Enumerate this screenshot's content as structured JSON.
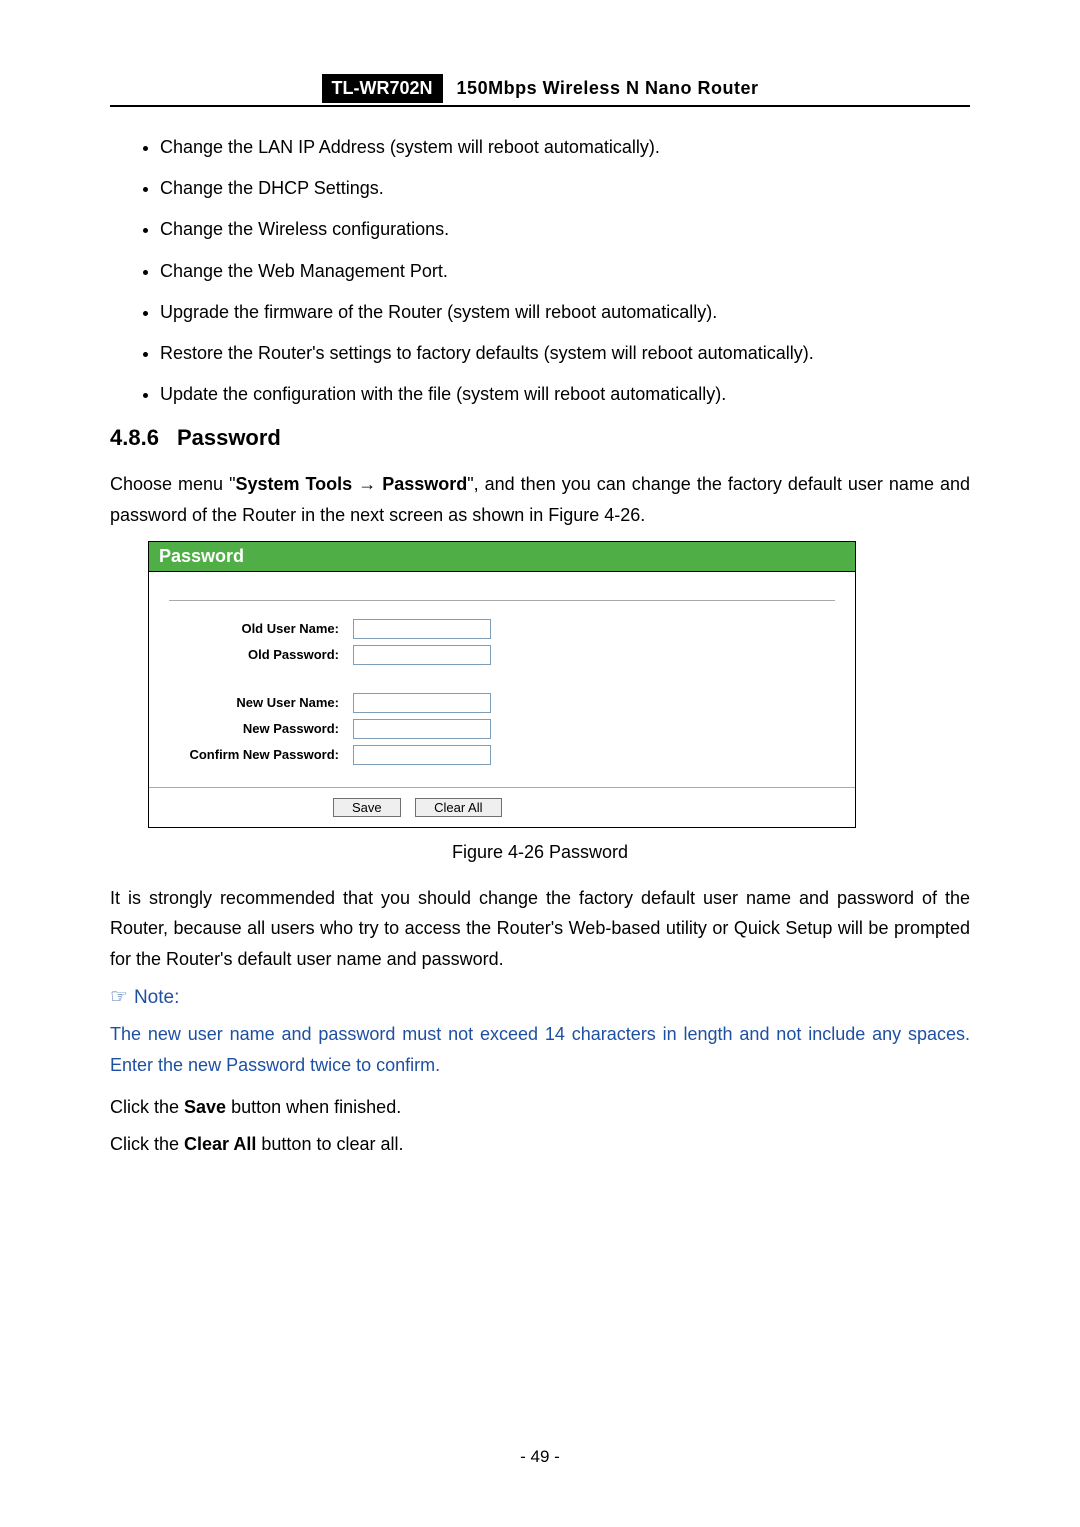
{
  "header": {
    "model": "TL-WR702N",
    "desc": "150Mbps  Wireless  N  Nano  Router"
  },
  "bullets": [
    "Change the LAN IP Address (system will reboot automatically).",
    "Change the DHCP Settings.",
    "Change the Wireless configurations.",
    "Change the Web Management Port.",
    "Upgrade the firmware of the Router (system will reboot automatically).",
    "Restore the Router's settings to factory defaults (system will reboot automatically).",
    "Update the configuration with the file (system will reboot automatically)."
  ],
  "section": {
    "number": "4.8.6",
    "title": "Password"
  },
  "intro": {
    "pre": "Choose menu \"",
    "menu1": "System Tools",
    "arrow": "→",
    "menu2": "Password",
    "post": "\", and then you can change the factory default user name and password of the Router in the next screen as shown in Figure 4-26."
  },
  "panel": {
    "title": "Password",
    "labels": {
      "oldUser": "Old User Name:",
      "oldPass": "Old Password:",
      "newUser": "New User Name:",
      "newPass": "New Password:",
      "confirm": "Confirm New Password:"
    },
    "values": {
      "oldUser": "",
      "oldPass": "",
      "newUser": "",
      "newPass": "",
      "confirm": ""
    },
    "buttons": {
      "save": "Save",
      "clear": "Clear All"
    }
  },
  "figCaption": "Figure 4-26    Password",
  "recommend": "It is strongly recommended that you should change the factory default user name and password of the Router, because all users who try to access the Router's Web-based utility or Quick Setup will be prompted for the Router's default user name and password.",
  "note": {
    "icon": "☞",
    "label": "Note:",
    "body": "The new user name and password must not exceed 14 characters in length and not include any spaces. Enter the new Password twice to confirm."
  },
  "clickSave": {
    "pre": "Click the ",
    "bold": "Save",
    "post": " button when finished."
  },
  "clickClear": {
    "pre": "Click the ",
    "bold": "Clear All",
    "post": " button to clear all."
  },
  "pageNumber": "- 49 -"
}
